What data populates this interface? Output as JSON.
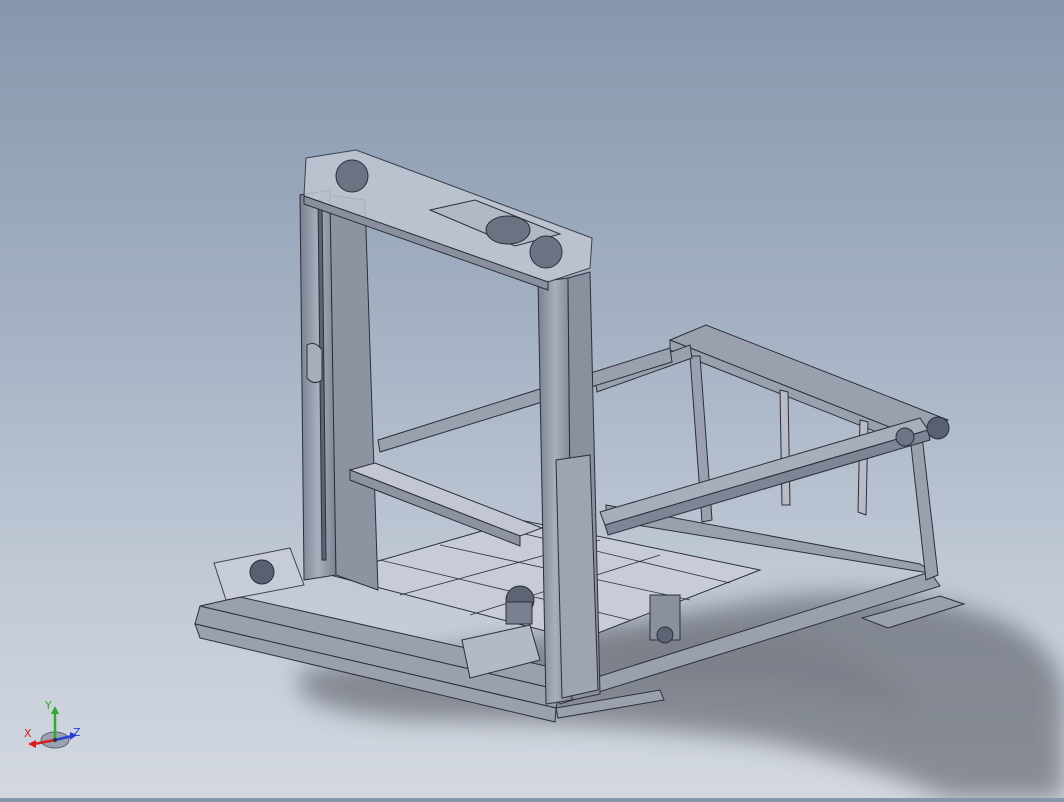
{
  "scene": {
    "model": "3d-cnc-gantry-frame-assembly",
    "render_mode": "shaded-with-edges"
  },
  "triad": {
    "x_label": "X",
    "y_label": "Y",
    "z_label": "Z",
    "colors": {
      "x": "#d21e1e",
      "y": "#2fa82f",
      "z": "#2a3fd6"
    }
  },
  "colors": {
    "background_top": "#8697ad",
    "background_bottom": "#d3d8e0",
    "frame_metal": "#9298a6",
    "frame_edge": "#2b2f3a",
    "glass_panel": "#c7ccd8",
    "shadow": "#4c5058"
  }
}
